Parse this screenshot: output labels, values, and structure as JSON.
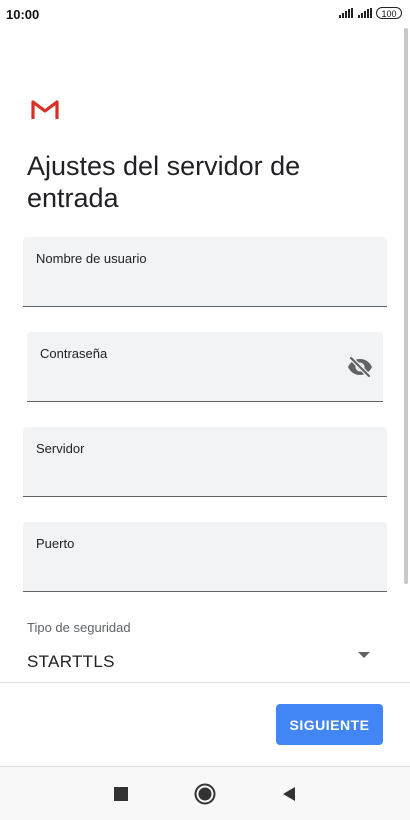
{
  "status_bar": {
    "time": "10:00",
    "battery": "100"
  },
  "page": {
    "title": "Ajustes del servidor de entrada"
  },
  "fields": {
    "username": {
      "label": "Nombre de usuario",
      "value": ""
    },
    "password": {
      "label": "Contraseña",
      "value": ""
    },
    "server": {
      "label": "Servidor",
      "value": ""
    },
    "port": {
      "label": "Puerto",
      "value": ""
    }
  },
  "security": {
    "label": "Tipo de seguridad",
    "value": "STARTTLS"
  },
  "actions": {
    "next_label": "SIGUIENTE"
  },
  "colors": {
    "accent": "#4285f4",
    "gmail_red": "#d93025"
  },
  "icons": {
    "logo": "gmail-logo",
    "password_toggle": "visibility-off-icon",
    "dropdown": "dropdown-arrow-icon",
    "nav": [
      "recents-icon",
      "home-icon",
      "back-icon"
    ]
  }
}
